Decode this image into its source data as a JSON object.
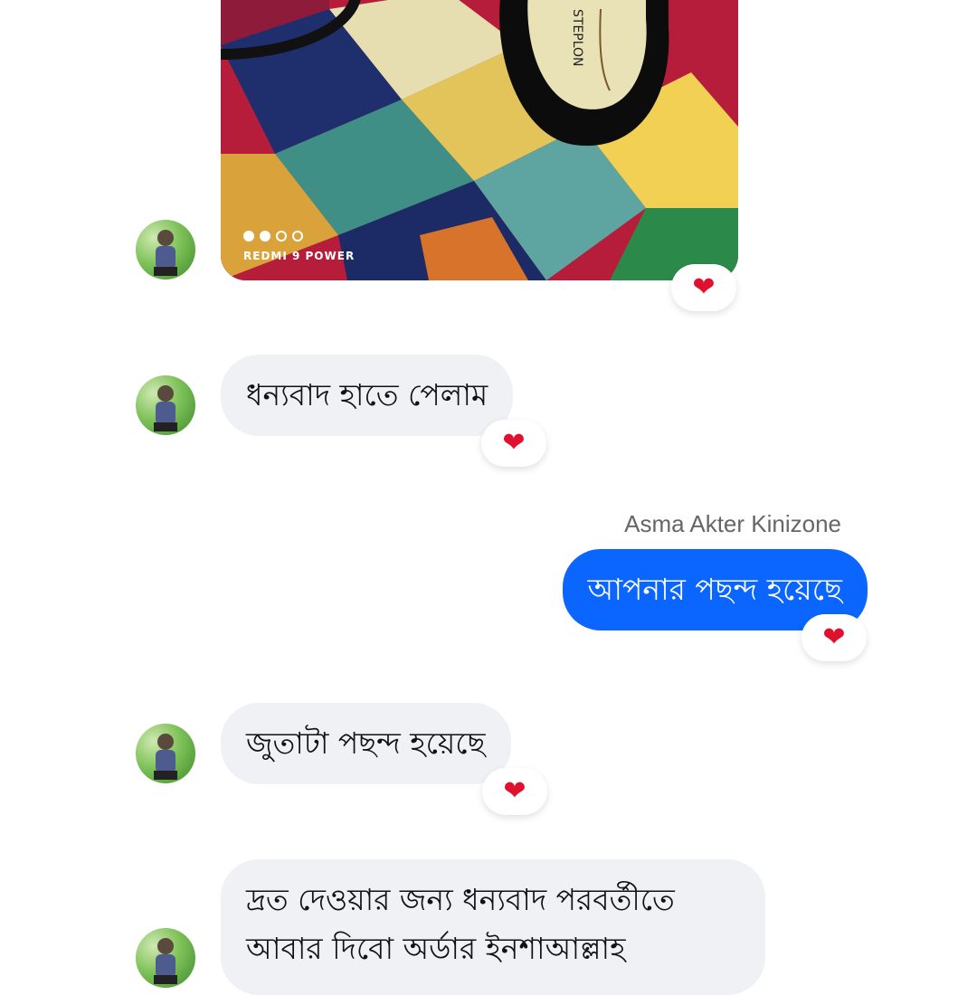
{
  "messages": [
    {
      "type": "image",
      "sender": "other",
      "watermark": "REDMI 9 POWER",
      "carousel": {
        "total": 4,
        "filled": 2
      },
      "reaction": "❤"
    },
    {
      "type": "text",
      "sender": "other",
      "text": "ধন্যবাদ হাতে পেলাম",
      "reaction": "❤"
    },
    {
      "type": "text",
      "sender": "me",
      "sender_name": "Asma Akter Kinizone",
      "text": "আপনার পছন্দ হয়েছে",
      "reaction": "❤"
    },
    {
      "type": "text",
      "sender": "other",
      "text": "জুতাটা পছন্দ হয়েছে",
      "reaction": "❤"
    },
    {
      "type": "text",
      "sender": "other",
      "lines": [
        "দ্রত দেওয়ার জন্য ধন্যবাদ পরবর্তীতে",
        "আবার দিবো অর্ডার ইনশাআল্লাহ"
      ]
    }
  ],
  "colors": {
    "outgoing_bubble": "#0a66ff",
    "incoming_bubble": "#f0f1f5",
    "heart": "#e0102f"
  },
  "icons": {
    "reaction": "heart-icon",
    "avatar": "avatar-photo"
  }
}
